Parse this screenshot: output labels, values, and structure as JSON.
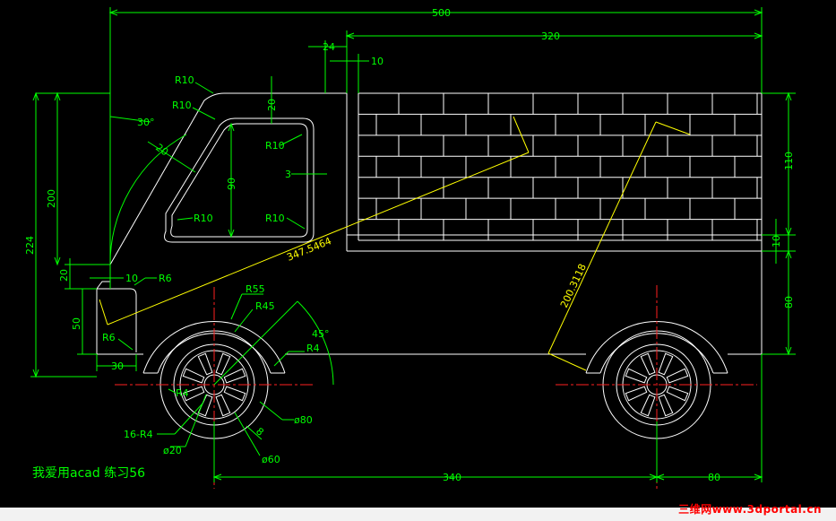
{
  "labels": {
    "dim_500": "500",
    "dim_320": "320",
    "dim_24": "24",
    "dim_10_top": "10",
    "r10_a": "R10",
    "r10_b": "R10",
    "dim_30deg": "30°",
    "dim_20_top": "20",
    "r10_c": "R10",
    "dim_20_slant": "20",
    "dim_90": "90",
    "dim_3": "3",
    "r10_d": "R10",
    "r10_e": "R10",
    "dim_200": "200",
    "dim_224": "224",
    "dim_3475464": "347.5464",
    "dim_20_left": "20",
    "dim_10_left": "10",
    "r6_a": "R6",
    "dim_50": "50",
    "r6_b": "R6",
    "dim_30_bottom": "30",
    "r55": "R55",
    "r45": "R45",
    "dim_45deg": "45°",
    "r4_a": "R4",
    "r4_b": "R4",
    "dim_16r4": "16-R4",
    "dim_phi80": "ø80",
    "dim_8": "8",
    "dim_phi20": "ø20",
    "dim_phi60": "ø60",
    "dim_2003118": "200.3118",
    "dim_110": "110",
    "dim_10_right": "10",
    "dim_80_right": "80",
    "dim_340": "340",
    "dim_80_bottom": "80"
  },
  "note": "我爱用acad 练习56",
  "watermark": "三维网www.3dportal.cn",
  "colors": {
    "background": "#000000",
    "dimension": "#00ff00",
    "outline": "#ffffff",
    "measure": "#ffff00",
    "centerline": "#ff2020",
    "watermark": "#ff0000"
  }
}
